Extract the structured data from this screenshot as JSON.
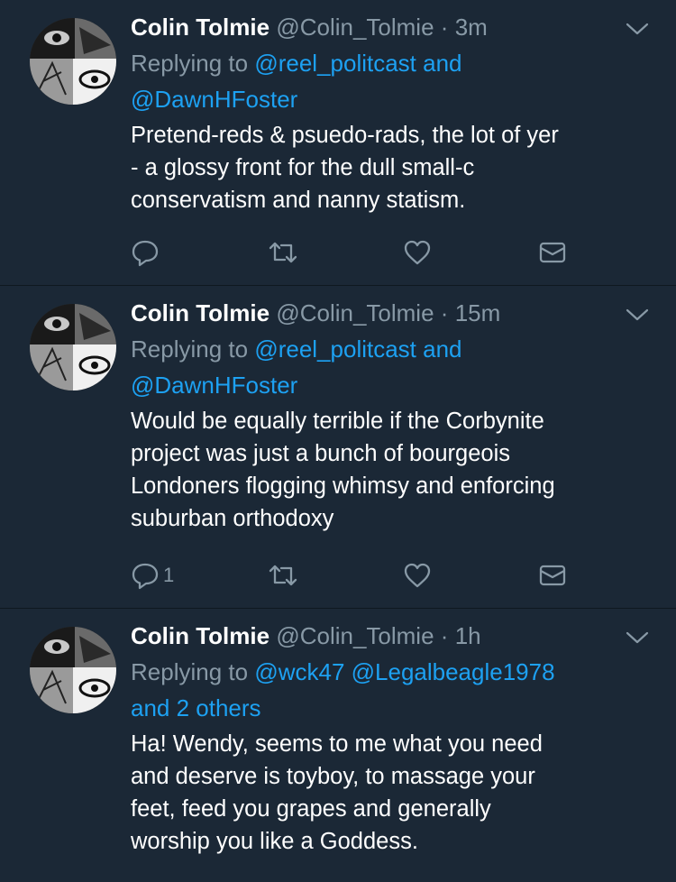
{
  "tweets": [
    {
      "name": "Colin Tolmie",
      "handle": "@Colin_Tolmie",
      "sep": "·",
      "time": "3m",
      "replying_prefix": "Replying to",
      "replying_line1": "@reel_politcast and",
      "replying_line2": "@DawnHFoster",
      "body": [
        "Pretend-reds & psuedo-rads, the lot of yer",
        "- a glossy front for the dull small-c",
        "conservatism and nanny statism."
      ],
      "reply_count": ""
    },
    {
      "name": "Colin Tolmie",
      "handle": "@Colin_Tolmie",
      "sep": "·",
      "time": "15m",
      "replying_prefix": "Replying to",
      "replying_line1": "@reel_politcast and",
      "replying_line2": "@DawnHFoster",
      "body": [
        "Would be equally terrible if the Corbynite",
        "project was just a bunch of bourgeois",
        "Londoners flogging whimsy and enforcing",
        "suburban orthodoxy"
      ],
      "reply_count": "1"
    },
    {
      "name": "Colin Tolmie",
      "handle": "@Colin_Tolmie",
      "sep": "·",
      "time": "1h",
      "replying_prefix": "Replying to",
      "replying_line1": "@wck47 @Legalbeagle1978",
      "replying_line2": "and 2 others",
      "body": [
        "Ha! Wendy, seems to me what you need",
        "and deserve is toyboy, to massage your",
        "feet, feed you grapes and generally",
        "worship you like a Goddess."
      ],
      "reply_count": ""
    }
  ],
  "icons": {
    "reply": "reply-icon",
    "retweet": "retweet-icon",
    "like": "heart-icon",
    "dm": "envelope-icon",
    "menu": "chevron-down-icon"
  },
  "colors": {
    "background": "#1b2836",
    "link": "#1da1f2",
    "muted": "#8899a6"
  }
}
